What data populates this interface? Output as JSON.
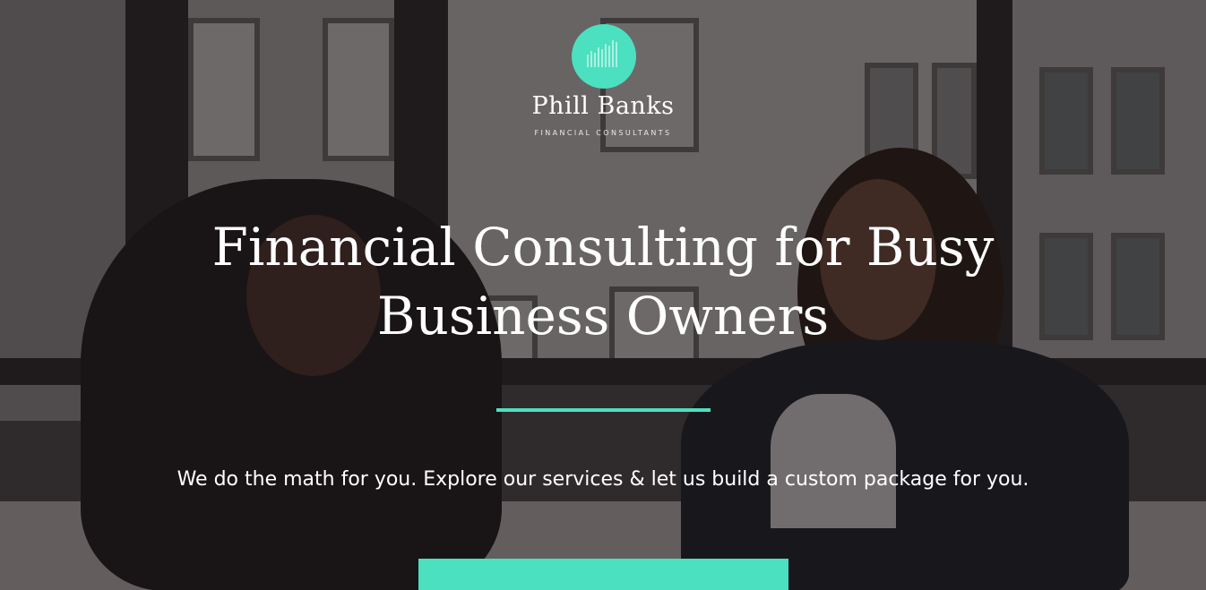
{
  "brand": {
    "name": "Phill Banks",
    "tagline": "FINANCIAL CONSULTANTS",
    "accent_color": "#4be0c0",
    "logo_icon": "bar-chart-icon"
  },
  "hero": {
    "headline_line1": "Financial Consulting for Busy",
    "headline_line2": "Business Owners",
    "subtext": "We do the math for you. Explore our services & let us build a custom package for you.",
    "cta_label": ""
  }
}
